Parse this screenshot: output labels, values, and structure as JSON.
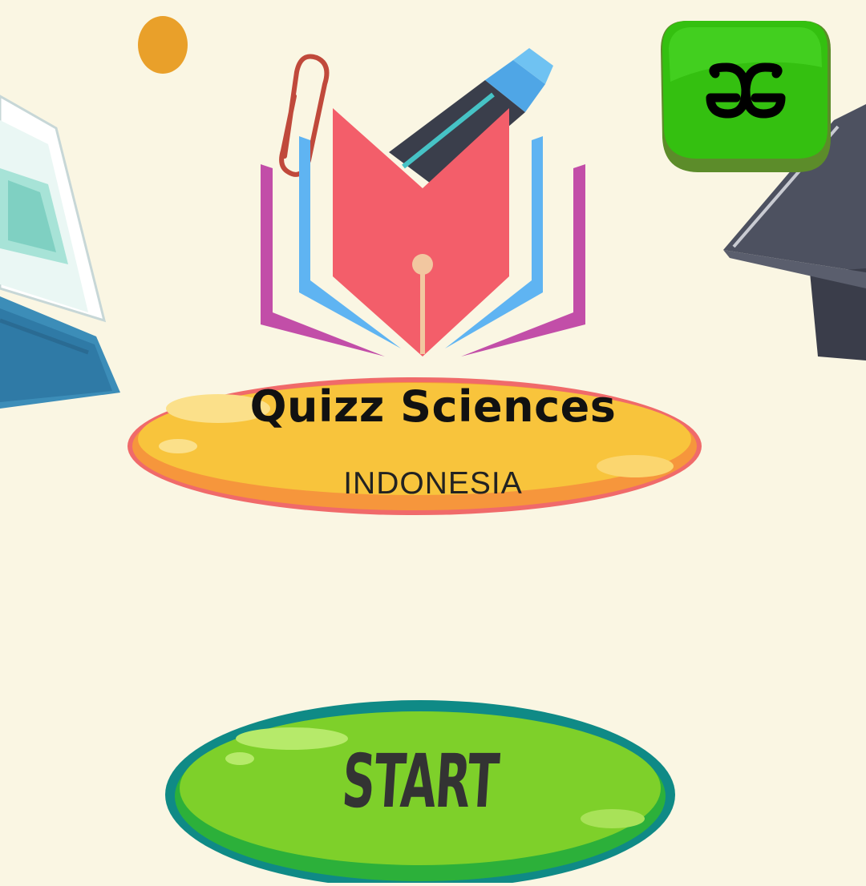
{
  "app": {
    "title": "Quizz Sciences",
    "subtitle": "INDONESIA"
  },
  "logo_badge": {
    "label": "GG",
    "icon": "gg-logo-icon"
  },
  "start_button": {
    "label": "START"
  },
  "colors": {
    "background": "#faf6e3",
    "banner": "#f8c43c",
    "banner_outline": "#f06a6a",
    "start_button": "#7ed02a",
    "start_outline": "#0f8a86",
    "badge": "#34c010",
    "book_red": "#f35e6a",
    "book_blue": "#5fb4f2",
    "book_purple": "#c24ea8"
  },
  "icons": [
    "textbook-icon",
    "graduation-cap-icon",
    "paperclip-icon",
    "marker-icon",
    "book-pen-logo-icon"
  ]
}
